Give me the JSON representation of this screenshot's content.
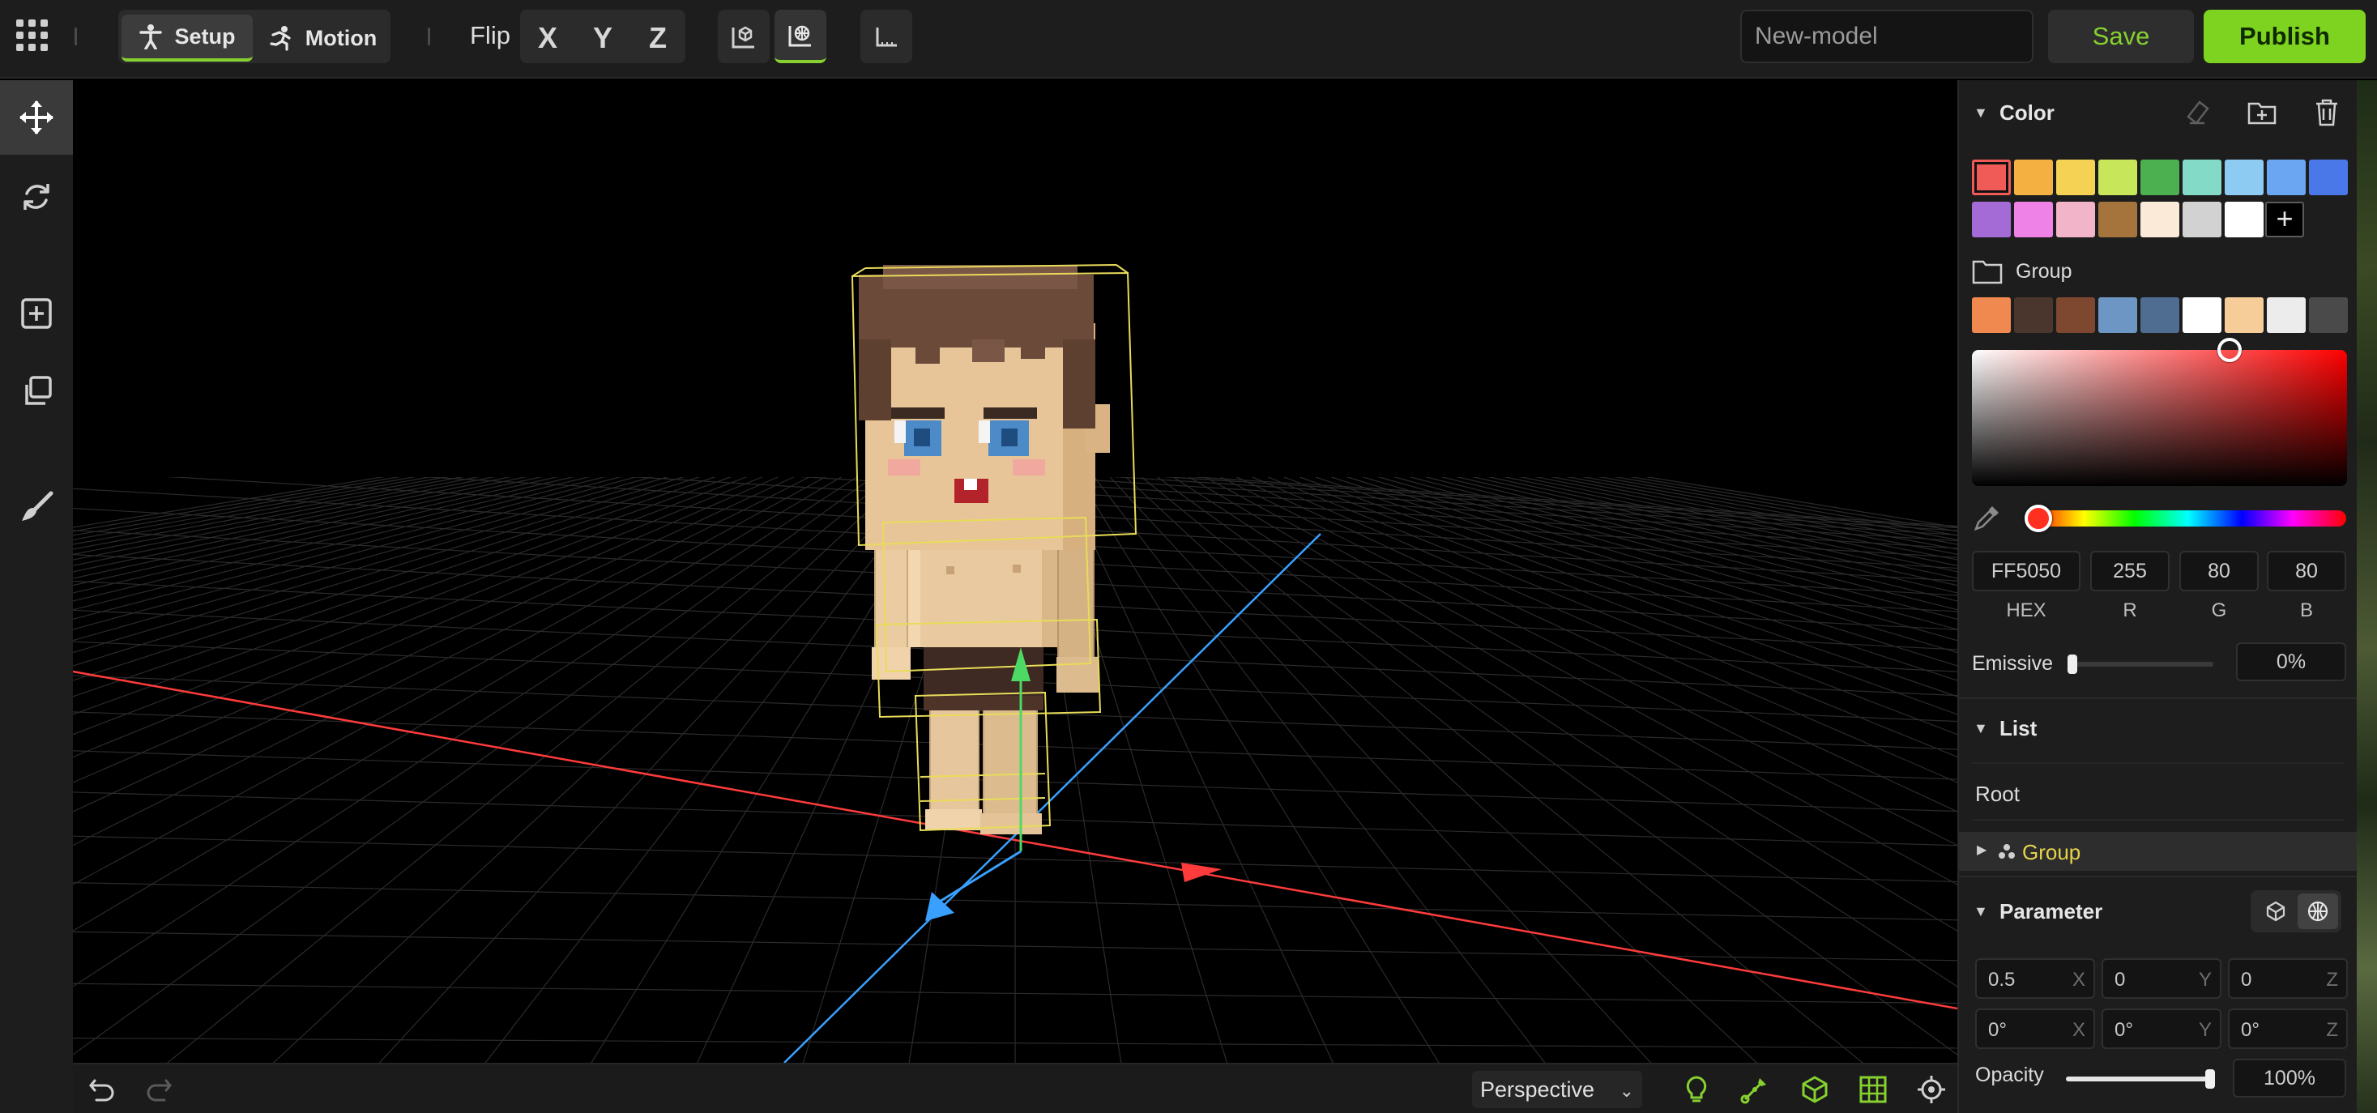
{
  "topbar": {
    "modes": [
      {
        "label": "Setup",
        "icon": "person-icon",
        "active": true
      },
      {
        "label": "Motion",
        "icon": "running-person-icon",
        "active": false
      }
    ],
    "flip_label": "Flip",
    "flip_axes": [
      "X",
      "Y",
      "Z"
    ],
    "model_name_placeholder": "New-model",
    "save_label": "Save",
    "publish_label": "Publish"
  },
  "left_tools": [
    "move-tool",
    "rotate-tool",
    "add-tool",
    "duplicate-tool",
    "paint-tool"
  ],
  "viewport": {
    "projection_value": "Perspective",
    "colors": {
      "x_axis": "#ff3b3b",
      "y_axis": "#4cd964",
      "z_axis": "#3aa0ff",
      "grid": "#2b2b2b",
      "selection": "#e8dc5a"
    }
  },
  "color_panel": {
    "title": "Color",
    "palette": [
      "#f05b57",
      "#f5b042",
      "#f5d253",
      "#c8e65a",
      "#4caf50",
      "#82dac7",
      "#8ecbf2",
      "#6aa6f2",
      "#4b78e8",
      "#a46ad6",
      "#ee82e6",
      "#f2b4c8",
      "#a4743c",
      "#fbead8",
      "#d2d2d2",
      "#ffffff"
    ],
    "group_label": "Group",
    "group_palette": [
      "#f0894f",
      "#4a362c",
      "#7e4730",
      "#6e96c4",
      "#4f6c91",
      "#ffffff",
      "#f6cc98",
      "#ececec",
      "#4a4a4a"
    ],
    "hex": "FF5050",
    "r": "255",
    "g": "80",
    "b": "80",
    "hex_label": "HEX",
    "r_label": "R",
    "g_label": "G",
    "b_label": "B",
    "emissive_label": "Emissive",
    "emissive_value": "0%",
    "emissive_level": 0
  },
  "list_panel": {
    "title": "List",
    "root_label": "Root",
    "group_label": "Group"
  },
  "parameter_panel": {
    "title": "Parameter",
    "position": [
      {
        "value": "0.5",
        "axis": "X"
      },
      {
        "value": "0",
        "axis": "Y"
      },
      {
        "value": "0",
        "axis": "Z"
      }
    ],
    "rotation": [
      {
        "value": "0°",
        "axis": "X"
      },
      {
        "value": "0°",
        "axis": "Y"
      },
      {
        "value": "0°",
        "axis": "Z"
      }
    ],
    "opacity_label": "Opacity",
    "opacity_value": "100%",
    "opacity_level": 1.0
  }
}
